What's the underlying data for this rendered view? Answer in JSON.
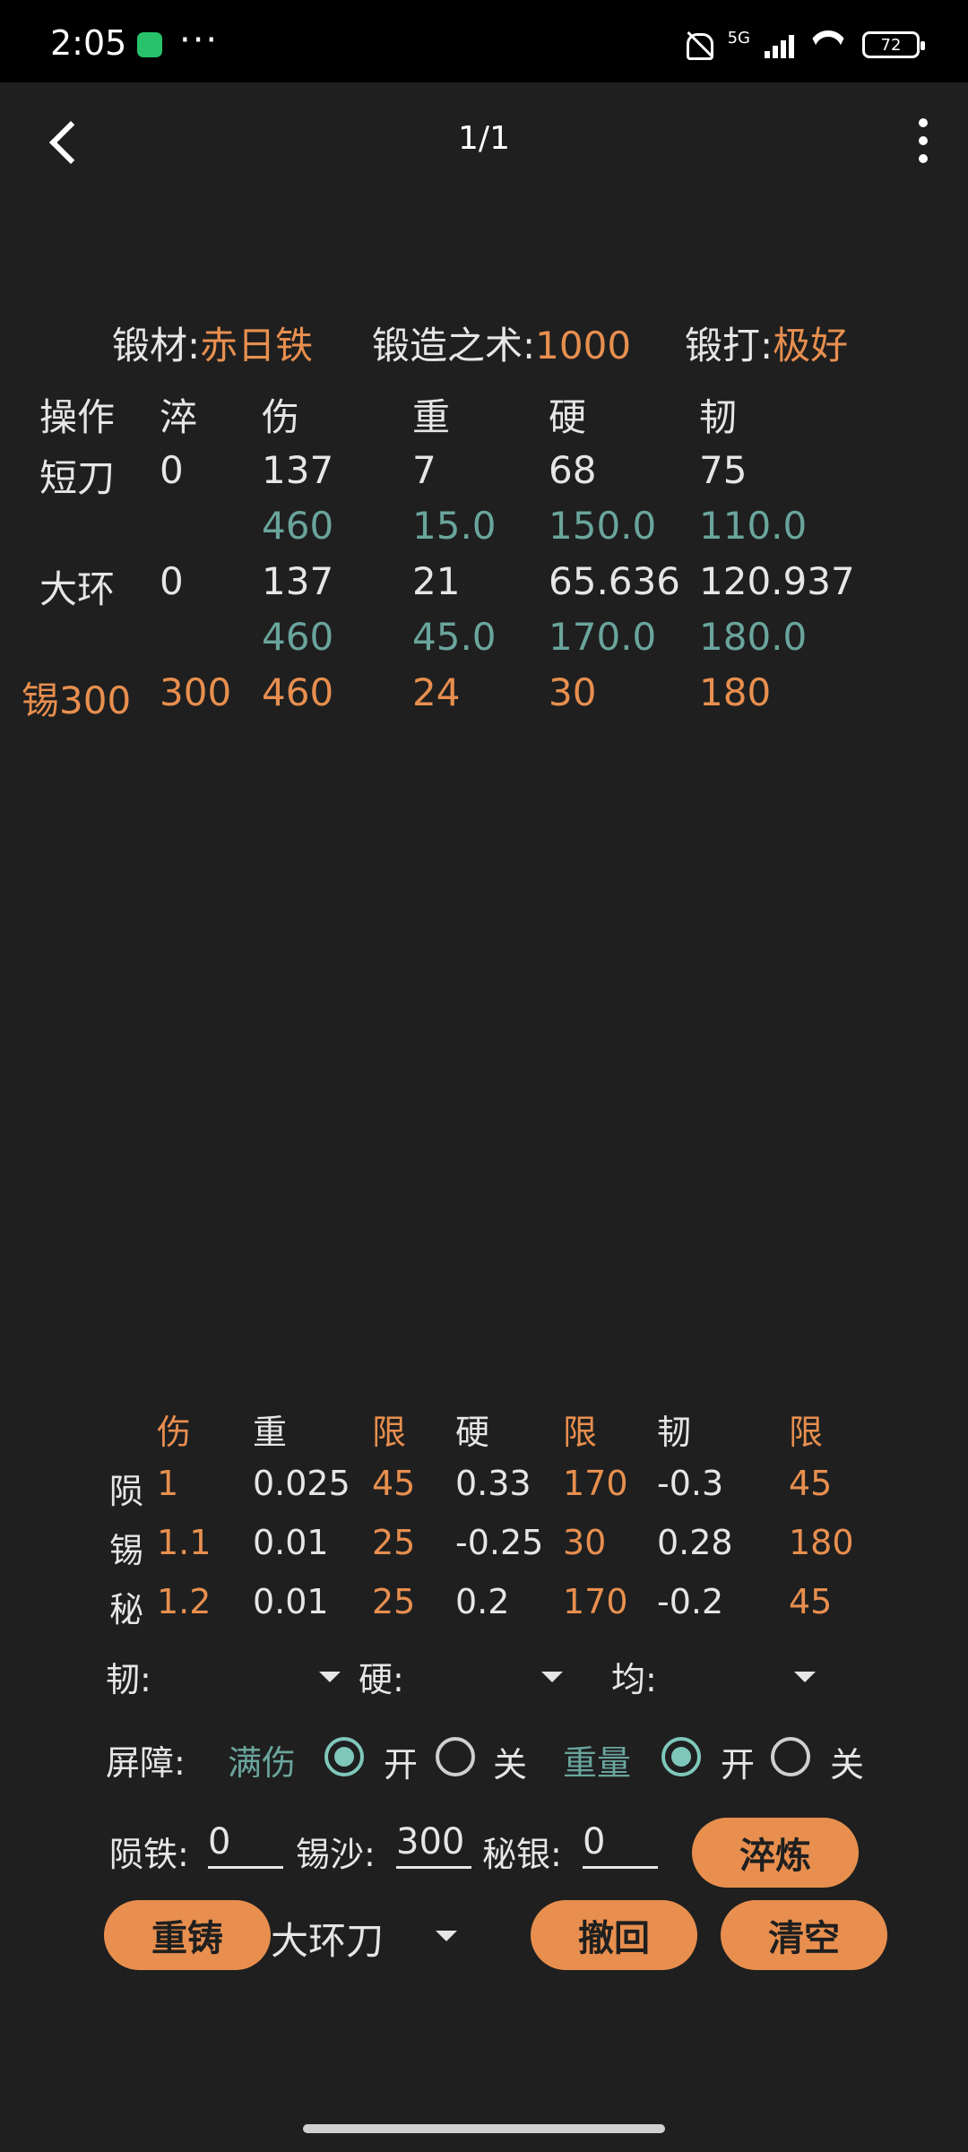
{
  "status": {
    "time": "2:05",
    "network": "5G",
    "battery": "72"
  },
  "titlebar": {
    "title": "1/1"
  },
  "header": {
    "material_label": "锻材:",
    "material_value": "赤日铁",
    "skill_label": "锻造之术:",
    "skill_value": "1000",
    "strike_label": "锻打:",
    "strike_value": "极好"
  },
  "table": {
    "headers": [
      "操作",
      "淬",
      "伤",
      "重",
      "硬",
      "韧"
    ],
    "rows": [
      {
        "op": "短刀",
        "cui": "0",
        "shang": "137",
        "zhong": "7",
        "ying": "68",
        "ren": "75"
      },
      {
        "op": "",
        "cui": "",
        "shang": "460",
        "zhong": "15.0",
        "ying": "150.0",
        "ren": "110.0"
      },
      {
        "op": "大环",
        "cui": "0",
        "shang": "137",
        "zhong": "21",
        "ying": "65.636",
        "ren": "120.937"
      },
      {
        "op": "",
        "cui": "",
        "shang": "460",
        "zhong": "45.0",
        "ying": "170.0",
        "ren": "180.0"
      },
      {
        "op": "锡300",
        "cui": "300",
        "shang": "460",
        "zhong": "24",
        "ying": "30",
        "ren": "180"
      }
    ]
  },
  "coef": {
    "headers": [
      "伤",
      "重",
      "限",
      "硬",
      "限",
      "韧",
      "限"
    ],
    "rows": [
      {
        "name": "陨",
        "shang": "1",
        "zhong": "0.025",
        "lim1": "45",
        "ying": "0.33",
        "lim2": "170",
        "ren": "-0.3",
        "lim3": "45"
      },
      {
        "name": "锡",
        "shang": "1.1",
        "zhong": "0.01",
        "lim1": "25",
        "ying": "-0.25",
        "lim2": "30",
        "ren": "0.28",
        "lim3": "180"
      },
      {
        "name": "秘",
        "shang": "1.2",
        "zhong": "0.01",
        "lim1": "25",
        "ying": "0.2",
        "lim2": "170",
        "ren": "-0.2",
        "lim3": "45"
      }
    ]
  },
  "dropdowns": {
    "ren": "韧:",
    "ying": "硬:",
    "jun": "均:"
  },
  "shield": {
    "label": "屏障:",
    "full_damage": "满伤",
    "on1": "开",
    "off1": "关",
    "weight": "重量",
    "on2": "开",
    "off2": "关"
  },
  "inputs": {
    "meteor_label": "陨铁:",
    "meteor_value": "0",
    "tin_label": "锡沙:",
    "tin_value": "300",
    "mithril_label": "秘银:",
    "mithril_value": "0"
  },
  "buttons": {
    "quench": "淬炼",
    "recast": "重铸",
    "weapon": "大环刀",
    "undo": "撤回",
    "clear": "清空"
  }
}
